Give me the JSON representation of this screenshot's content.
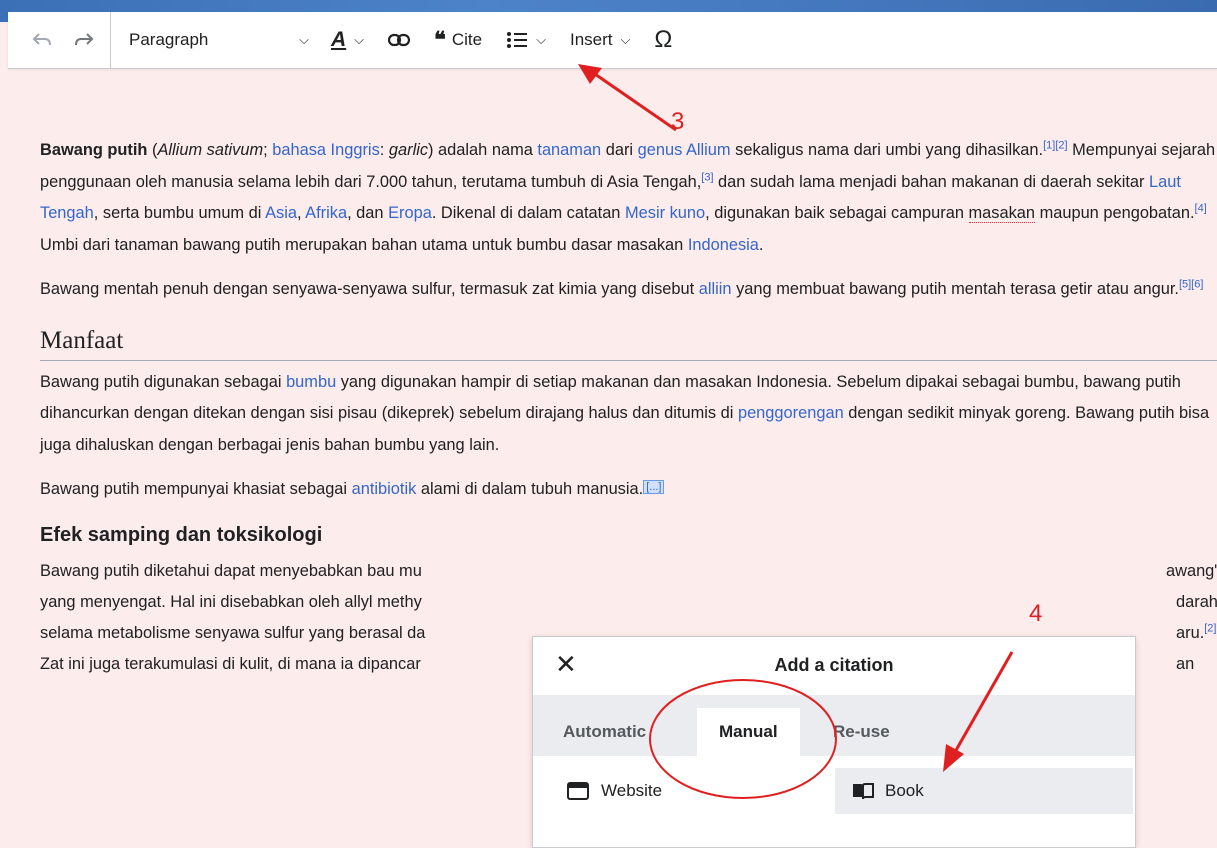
{
  "toolbar": {
    "undo_icon": "undo-icon",
    "redo_icon": "redo-icon",
    "paragraph": "Paragraph",
    "style_icon": "A",
    "link_icon": "link-icon",
    "cite_icon": "❝",
    "cite": "Cite",
    "list_icon": "list-icon",
    "insert": "Insert",
    "special_char": "Ω"
  },
  "article": {
    "p1": {
      "bold": "Bawang putih",
      "a": " (",
      "sci": "Allium sativum",
      "b": "; ",
      "l_bahasa": "bahasa Inggris",
      "c": ": ",
      "garlic": "garlic",
      "d": ") adalah nama ",
      "l_tanaman": "tanaman",
      "e": " dari ",
      "l_genus": "genus Allium",
      "f": " sekaligus nama dari umbi yang dihasilkan.",
      "r1": "[1][2]",
      "g": " Mempunyai sejarah penggunaan oleh manusia selama lebih dari 7.000 tahun, terutama tumbuh di Asia Tengah,",
      "r2": "[3]",
      "h": " dan sudah lama menjadi bahan makanan di daerah sekitar ",
      "l_laut": "Laut Tengah",
      "i": ", serta bumbu umum di ",
      "l_asia": "Asia",
      "j": ", ",
      "l_afrika": "Afrika",
      "k": ", dan ",
      "l_eropa": "Eropa",
      "l": ". Dikenal di dalam catatan ",
      "l_mesir": "Mesir kuno",
      "m": ", digunakan baik sebagai campuran ",
      "masakan": "masakan",
      "n": " maupun pengobatan.",
      "r3": "[4]",
      "o": " Umbi dari tanaman bawang putih merupakan bahan utama untuk bumbu dasar masakan ",
      "l_indonesia": "Indonesia",
      "p": "."
    },
    "p2": {
      "a": "Bawang mentah penuh dengan senyawa-senyawa sulfur, termasuk zat kimia yang disebut ",
      "l_alliin": "alliin",
      "b": " yang membuat bawang putih mentah terasa getir atau angur.",
      "r": "[5][6]"
    },
    "h_manfaat": "Manfaat",
    "p3": {
      "a": "Bawang putih digunakan sebagai ",
      "l_bumbu": "bumbu",
      "b": " yang digunakan hampir di setiap makanan dan masakan Indonesia. Sebelum dipakai sebagai bumbu, bawang putih dihancurkan dengan ditekan dengan sisi pisau (dikeprek) sebelum dirajang halus dan ditumis di ",
      "l_penggorengan": "penggorengan",
      "c": " dengan sedikit minyak goreng. Bawang putih bisa juga dihaluskan dengan berbagai jenis bahan bumbu yang lain."
    },
    "p4": {
      "a": "Bawang putih mempunyai khasiat sebagai ",
      "l_antibiotik": "antibiotik",
      "b": " alami di dalam tubuh manusia.",
      "ref": "[...]"
    },
    "h_efek": "Efek samping dan toksikologi",
    "p5": {
      "l1a": "Bawang putih diketahui dapat menyebabkan bau mu",
      "l1b": "awang\"",
      "l2a": "yang menyengat. Hal ini disebabkan oleh allyl methy",
      "l2b": "darah",
      "l3a": "selama metabolisme senyawa sulfur yang berasal da",
      "l3b": "aru.",
      "l3r": "[2]",
      "l4a": "Zat ini juga terakumulasi di kulit, di mana ia dipancar",
      "l4b": "an"
    }
  },
  "dialog": {
    "close_icon": "✕",
    "title": "Add a citation",
    "tabs": [
      "Automatic",
      "Manual",
      "Re-use"
    ],
    "options": [
      "Website",
      "Book"
    ]
  },
  "annotations": {
    "label_3": "3",
    "label_4": "4",
    "color": "#e02020"
  }
}
